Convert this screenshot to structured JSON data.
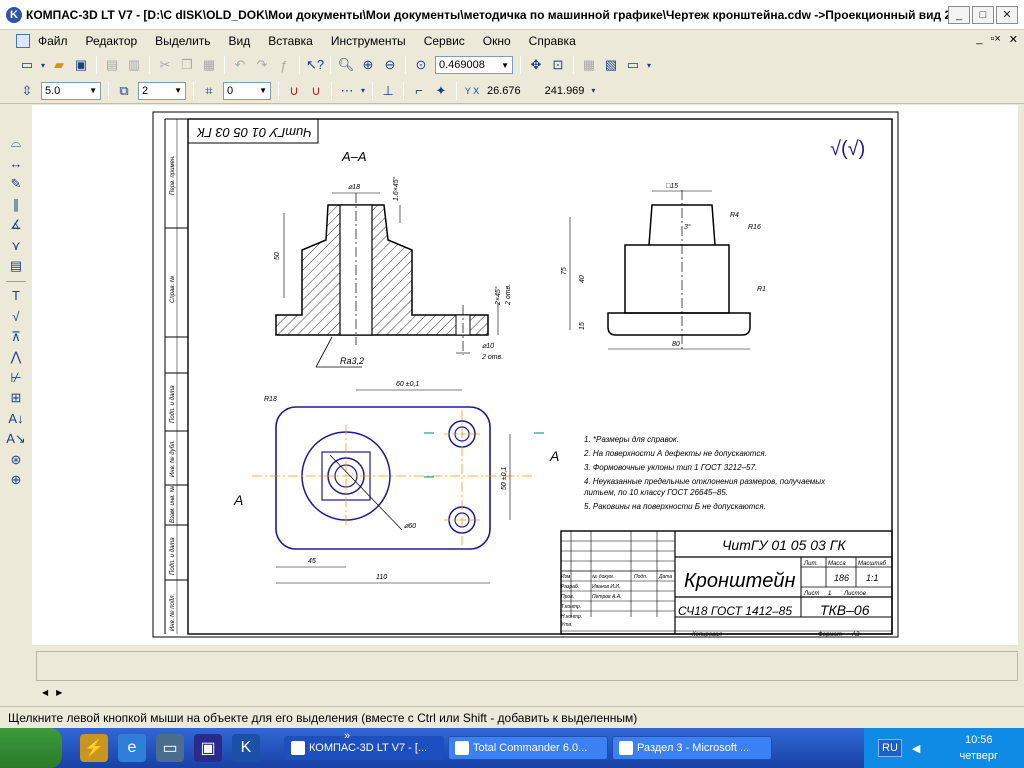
{
  "window": {
    "title": "КОМПАС-3D LT V7 - [D:\\C dISK\\OLD_DOK\\Мои документы\\Мои документы\\методичка по машинной графике\\Чертеж кронштейна.cdw ->Проекционный вид 2]",
    "min": "_",
    "max": "□",
    "close": "✕"
  },
  "menu": [
    "Файл",
    "Редактор",
    "Выделить",
    "Вид",
    "Вставка",
    "Инструменты",
    "Сервис",
    "Окно",
    "Справка"
  ],
  "menu_right": [
    "_",
    "▫×",
    "✕"
  ],
  "toolbar1": {
    "zoom_value": "0.469008"
  },
  "toolbar2": {
    "step": "5.0",
    "layer": "2",
    "style": "0",
    "x_value": "26.676",
    "y_value": "241.969"
  },
  "drawing": {
    "section_label": "А–А",
    "stamp_code_rotated": "ЧитГУ 01 05 03 ГК",
    "roughness_mark": "√(√)",
    "dims": {
      "d18_top": "⌀18",
      "chamfer_top": "1.6×45°",
      "h50": "50",
      "chamfer_bot": "2×45°",
      "holes": "2 отв.",
      "d10": "⌀10",
      "holes2": "2 отв.",
      "ra": "Ra3,2",
      "sq15": "□15",
      "r4": "R4",
      "r16": "R16",
      "r1": "R1",
      "angle": "3°",
      "h75": "75",
      "h40": "40",
      "h15": "15",
      "w80": "80",
      "d60": "60 ±0,1",
      "v50": "50 ±0,1",
      "r18": "R18",
      "d60b": "⌀60",
      "w45": "45",
      "w110": "110",
      "cut_a1": "А",
      "cut_a2": "А"
    },
    "notes": [
      "1. *Размеры для справок.",
      "2. На поверхности А дефекты не допускаются.",
      "3. Формовочные уклоны тип 1 ГОСТ 3212–57.",
      "4. Неуказанные предельные отклонения размеров, получаемых",
      "    литьем, по 10 классу ГОСТ 26645–85.",
      "5. Раковины на поверхности Б не допускаются."
    ],
    "stamp": {
      "code": "ЧитГУ 01 05 03 ГК",
      "name": "Кронштейн",
      "material": "СЧ18   ГОСТ 1412–85",
      "org": "ТКВ–06",
      "lit_h": "Лит.",
      "mass_h": "Масса",
      "scale_h": "Масштаб",
      "mass": "186",
      "scale": "1:1",
      "sheet": "Лист",
      "sheet_n": "1",
      "sheets": "Листов",
      "copied": "Копировал",
      "format": "Формат",
      "format_v": "А3",
      "rows": [
        {
          "role": "Изм.",
          "col2": "№ докум.",
          "col3": "Подп.",
          "col4": "Дата"
        },
        {
          "role": "Разраб.",
          "col2": "Иванов И.И."
        },
        {
          "role": "Пров.",
          "col2": "Петров А.А."
        },
        {
          "role": "Т.контр."
        },
        {
          "role": ""
        },
        {
          "role": "Н.контр."
        },
        {
          "role": "Утв."
        }
      ]
    },
    "side_cells": [
      "Перв. примен.",
      "Справ. №",
      "Подп. и дата",
      "Инв. № дубл.",
      "Взам. инв. №",
      "Подп. и дата",
      "Инв. № подл."
    ]
  },
  "status_text": "Щелкните левой кнопкой мыши на объекте для его выделения (вместе с Ctrl или Shift - добавить к выделенным)",
  "taskbar": {
    "tasks": [
      "КОМПАС-3D LT V7 - [...",
      "Total Commander 6.0...",
      "Раздел 3 - Microsoft ..."
    ],
    "chevron": "»",
    "lang": "RU",
    "time": "10:56",
    "day": "четверг"
  },
  "colors": {
    "accent": "#1941a5",
    "drawing_line": "#000000",
    "geometry": "#1a1aa0",
    "centerline": "#ff9900"
  }
}
